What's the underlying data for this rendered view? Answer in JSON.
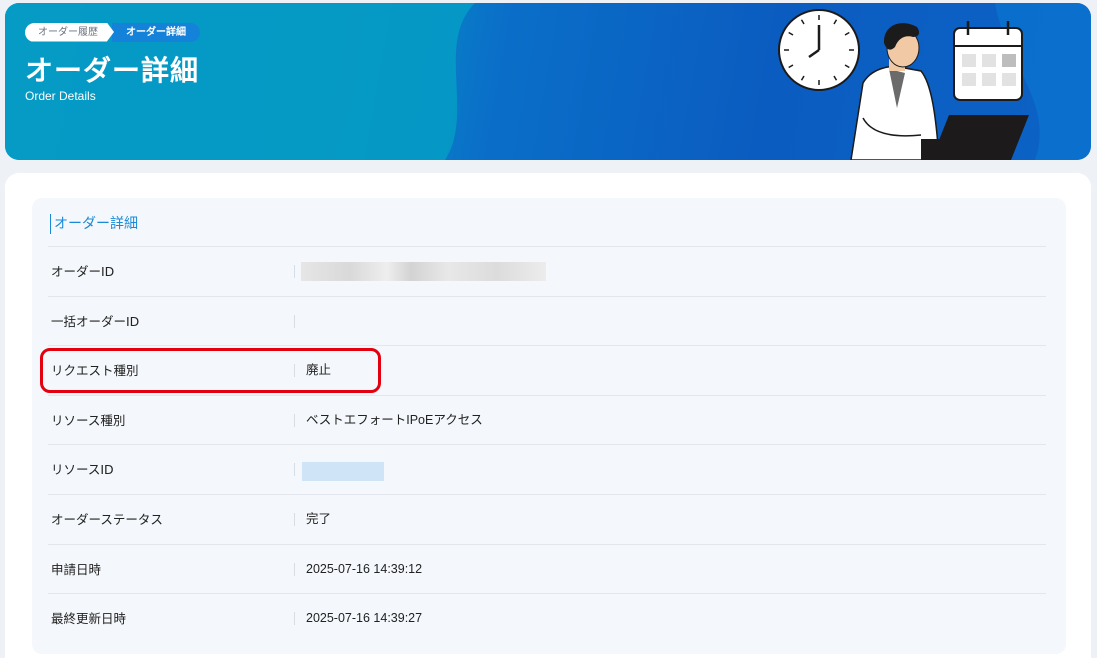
{
  "breadcrumb": {
    "items": [
      "オーダー履歴",
      "オーダー詳細"
    ]
  },
  "header": {
    "title": "オーダー詳細",
    "subtitle": "Order Details"
  },
  "section": {
    "heading": "オーダー詳細"
  },
  "details": [
    {
      "label": "オーダーID",
      "value": ""
    },
    {
      "label": "一括オーダーID",
      "value": ""
    },
    {
      "label": "リクエスト種別",
      "value": "廃止"
    },
    {
      "label": "リソース種別",
      "value": "ベストエフォートIPoEアクセス"
    },
    {
      "label": "リソースID",
      "value": ""
    },
    {
      "label": "オーダーステータス",
      "value": "完了"
    },
    {
      "label": "申請日時",
      "value": "2025-07-16 14:39:12"
    },
    {
      "label": "最終更新日時",
      "value": "2025-07-16 14:39:27"
    }
  ],
  "colors": {
    "accent": "#1a8ad6",
    "highlight": "#e4000f",
    "banner": "#0b5cc0"
  },
  "icons": [
    "clock-icon",
    "calendar-icon",
    "person-illustration",
    "laptop-icon"
  ]
}
